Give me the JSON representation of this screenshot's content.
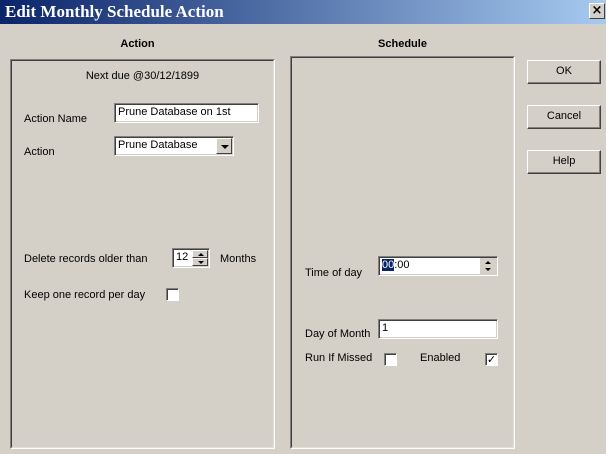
{
  "window": {
    "title": "Edit Monthly Schedule Action",
    "close_glyph": "×"
  },
  "action_section": {
    "header": "Action",
    "next_due": "Next due @30/12/1899",
    "action_name_label": "Action Name",
    "action_name_value": "Prune Database on 1st",
    "action_label": "Action",
    "action_value": "Prune Database",
    "delete_label": "Delete records older than",
    "delete_value": "12",
    "delete_unit": "Months",
    "keep_label": "Keep one record per day",
    "keep_checked": false
  },
  "schedule_section": {
    "header": "Schedule",
    "time_label": "Time of day",
    "time_highlight": "00",
    "time_rest": ":00",
    "dom_label": "Day of Month",
    "dom_value": "1",
    "run_missed_label": "Run If Missed",
    "run_missed_mark": "",
    "enabled_label": "Enabled",
    "enabled_mark": "✓"
  },
  "buttons": {
    "ok": "OK",
    "cancel": "Cancel",
    "help": "Help"
  },
  "icons": {
    "dropdown": "chevron-down-icon",
    "spinner": "spinner-arrows-icon",
    "close": "close-icon"
  }
}
